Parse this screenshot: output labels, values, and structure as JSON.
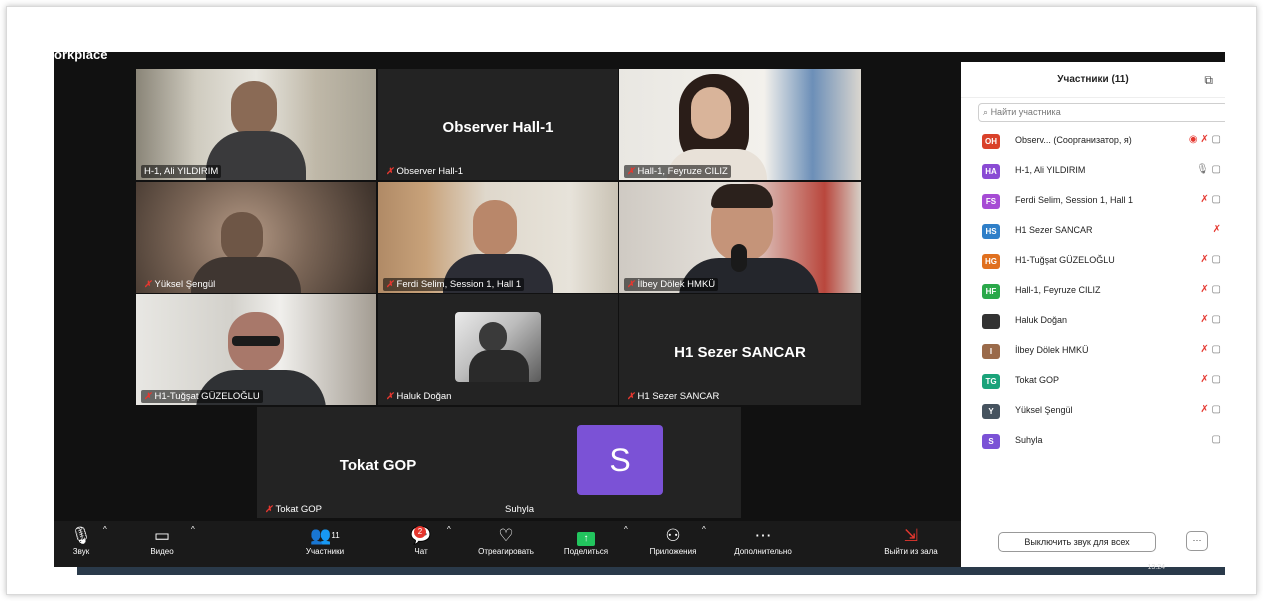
{
  "window": {
    "title": "orkplace"
  },
  "tiles": [
    {
      "name": "H-1, Ali YILDIRIM",
      "muted": false,
      "big_name": ""
    },
    {
      "name": "Observer Hall-1",
      "muted": true,
      "big_name": "Observer Hall-1"
    },
    {
      "name": "Hall-1, Feyruze CILIZ",
      "muted": true,
      "big_name": ""
    },
    {
      "name": "Yüksel Şengül",
      "muted": true,
      "big_name": ""
    },
    {
      "name": "Ferdi Selim, Session 1, Hall 1",
      "muted": true,
      "big_name": ""
    },
    {
      "name": "İlbey Dölek HMKÜ",
      "muted": true,
      "big_name": ""
    },
    {
      "name": "H1-Tuğşat GÜZELOĞLU",
      "muted": true,
      "big_name": ""
    },
    {
      "name": "Haluk Doğan",
      "muted": true,
      "big_name": ""
    },
    {
      "name": "H1 Sezer SANCAR",
      "muted": true,
      "big_name": "H1 Sezer SANCAR"
    },
    {
      "name": "Tokat GOP",
      "muted": true,
      "big_name": "Tokat GOP"
    },
    {
      "name": "Suhyla",
      "muted": false,
      "big_name": "",
      "avatar_letter": "S"
    }
  ],
  "toolbar": {
    "audio": "Звук",
    "video": "Видео",
    "participants": "Участники",
    "participants_count": "11",
    "chat": "Чат",
    "chat_badge": "2",
    "react": "Отреагировать",
    "share": "Поделиться",
    "apps": "Приложения",
    "more": "Дополнительно",
    "leave": "Выйти из зала"
  },
  "panel": {
    "title": "Участники (11)",
    "search_placeholder": "Найти участника",
    "mute_all": "Выключить звук для всех",
    "more_button": "···",
    "participants": [
      {
        "initials": "OH",
        "color": "#d9412a",
        "name": "Observ...  (Соорганизатор, я)"
      },
      {
        "initials": "HA",
        "color": "#8a4bd4",
        "name": "H-1, Ali YILDIRIM"
      },
      {
        "initials": "FS",
        "color": "#a64bd4",
        "name": "Ferdi Selim, Session 1, Hall 1"
      },
      {
        "initials": "HS",
        "color": "#2f7fc8",
        "name": "H1 Sezer SANCAR"
      },
      {
        "initials": "HG",
        "color": "#e0701f",
        "name": "H1-Tuğşat GÜZELOĞLU"
      },
      {
        "initials": "HF",
        "color": "#2aa84a",
        "name": "Hall-1, Feyruze CILIZ"
      },
      {
        "initials": "",
        "color": "#333333",
        "name": "Haluk Doğan"
      },
      {
        "initials": "I",
        "color": "#9a6a4a",
        "name": "İlbey Dölek HMKÜ"
      },
      {
        "initials": "TG",
        "color": "#1aa37a",
        "name": "Tokat GOP"
      },
      {
        "initials": "Y",
        "color": "#46535f",
        "name": "Yüksel Şengül"
      },
      {
        "initials": "S",
        "color": "#7b52d6",
        "name": "Suhyla"
      }
    ]
  },
  "taskbar": {
    "clock": "13:24"
  },
  "colors": {
    "active_speaker": "#2ccf74",
    "muted_icon": "#e5372f",
    "suhyla_avatar": "#7b52d6"
  }
}
